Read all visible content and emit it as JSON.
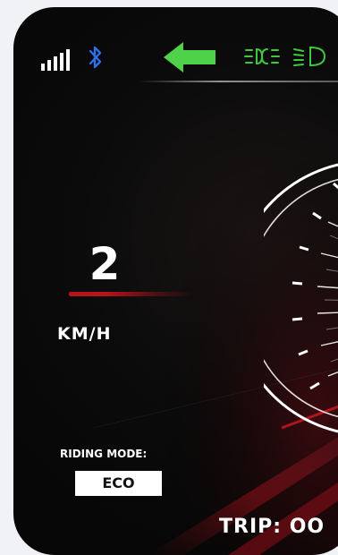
{
  "status_bar": {
    "icons": [
      "signal-strength-icon",
      "bluetooth-icon",
      "left-turn-arrow-icon",
      "parking-light-icon",
      "low-beam-icon"
    ],
    "colors": {
      "signal": "#ffffff",
      "bluetooth": "#2f6fe4",
      "turn_indicator": "#4fd14a",
      "lights": "#41c640"
    }
  },
  "speed": {
    "value": "2",
    "unit": "KM/H",
    "accent_color": "#b8121a"
  },
  "riding_mode": {
    "label": "RIDING MODE:",
    "value": "ECO"
  },
  "trip": {
    "text": "TRIP: OO"
  }
}
